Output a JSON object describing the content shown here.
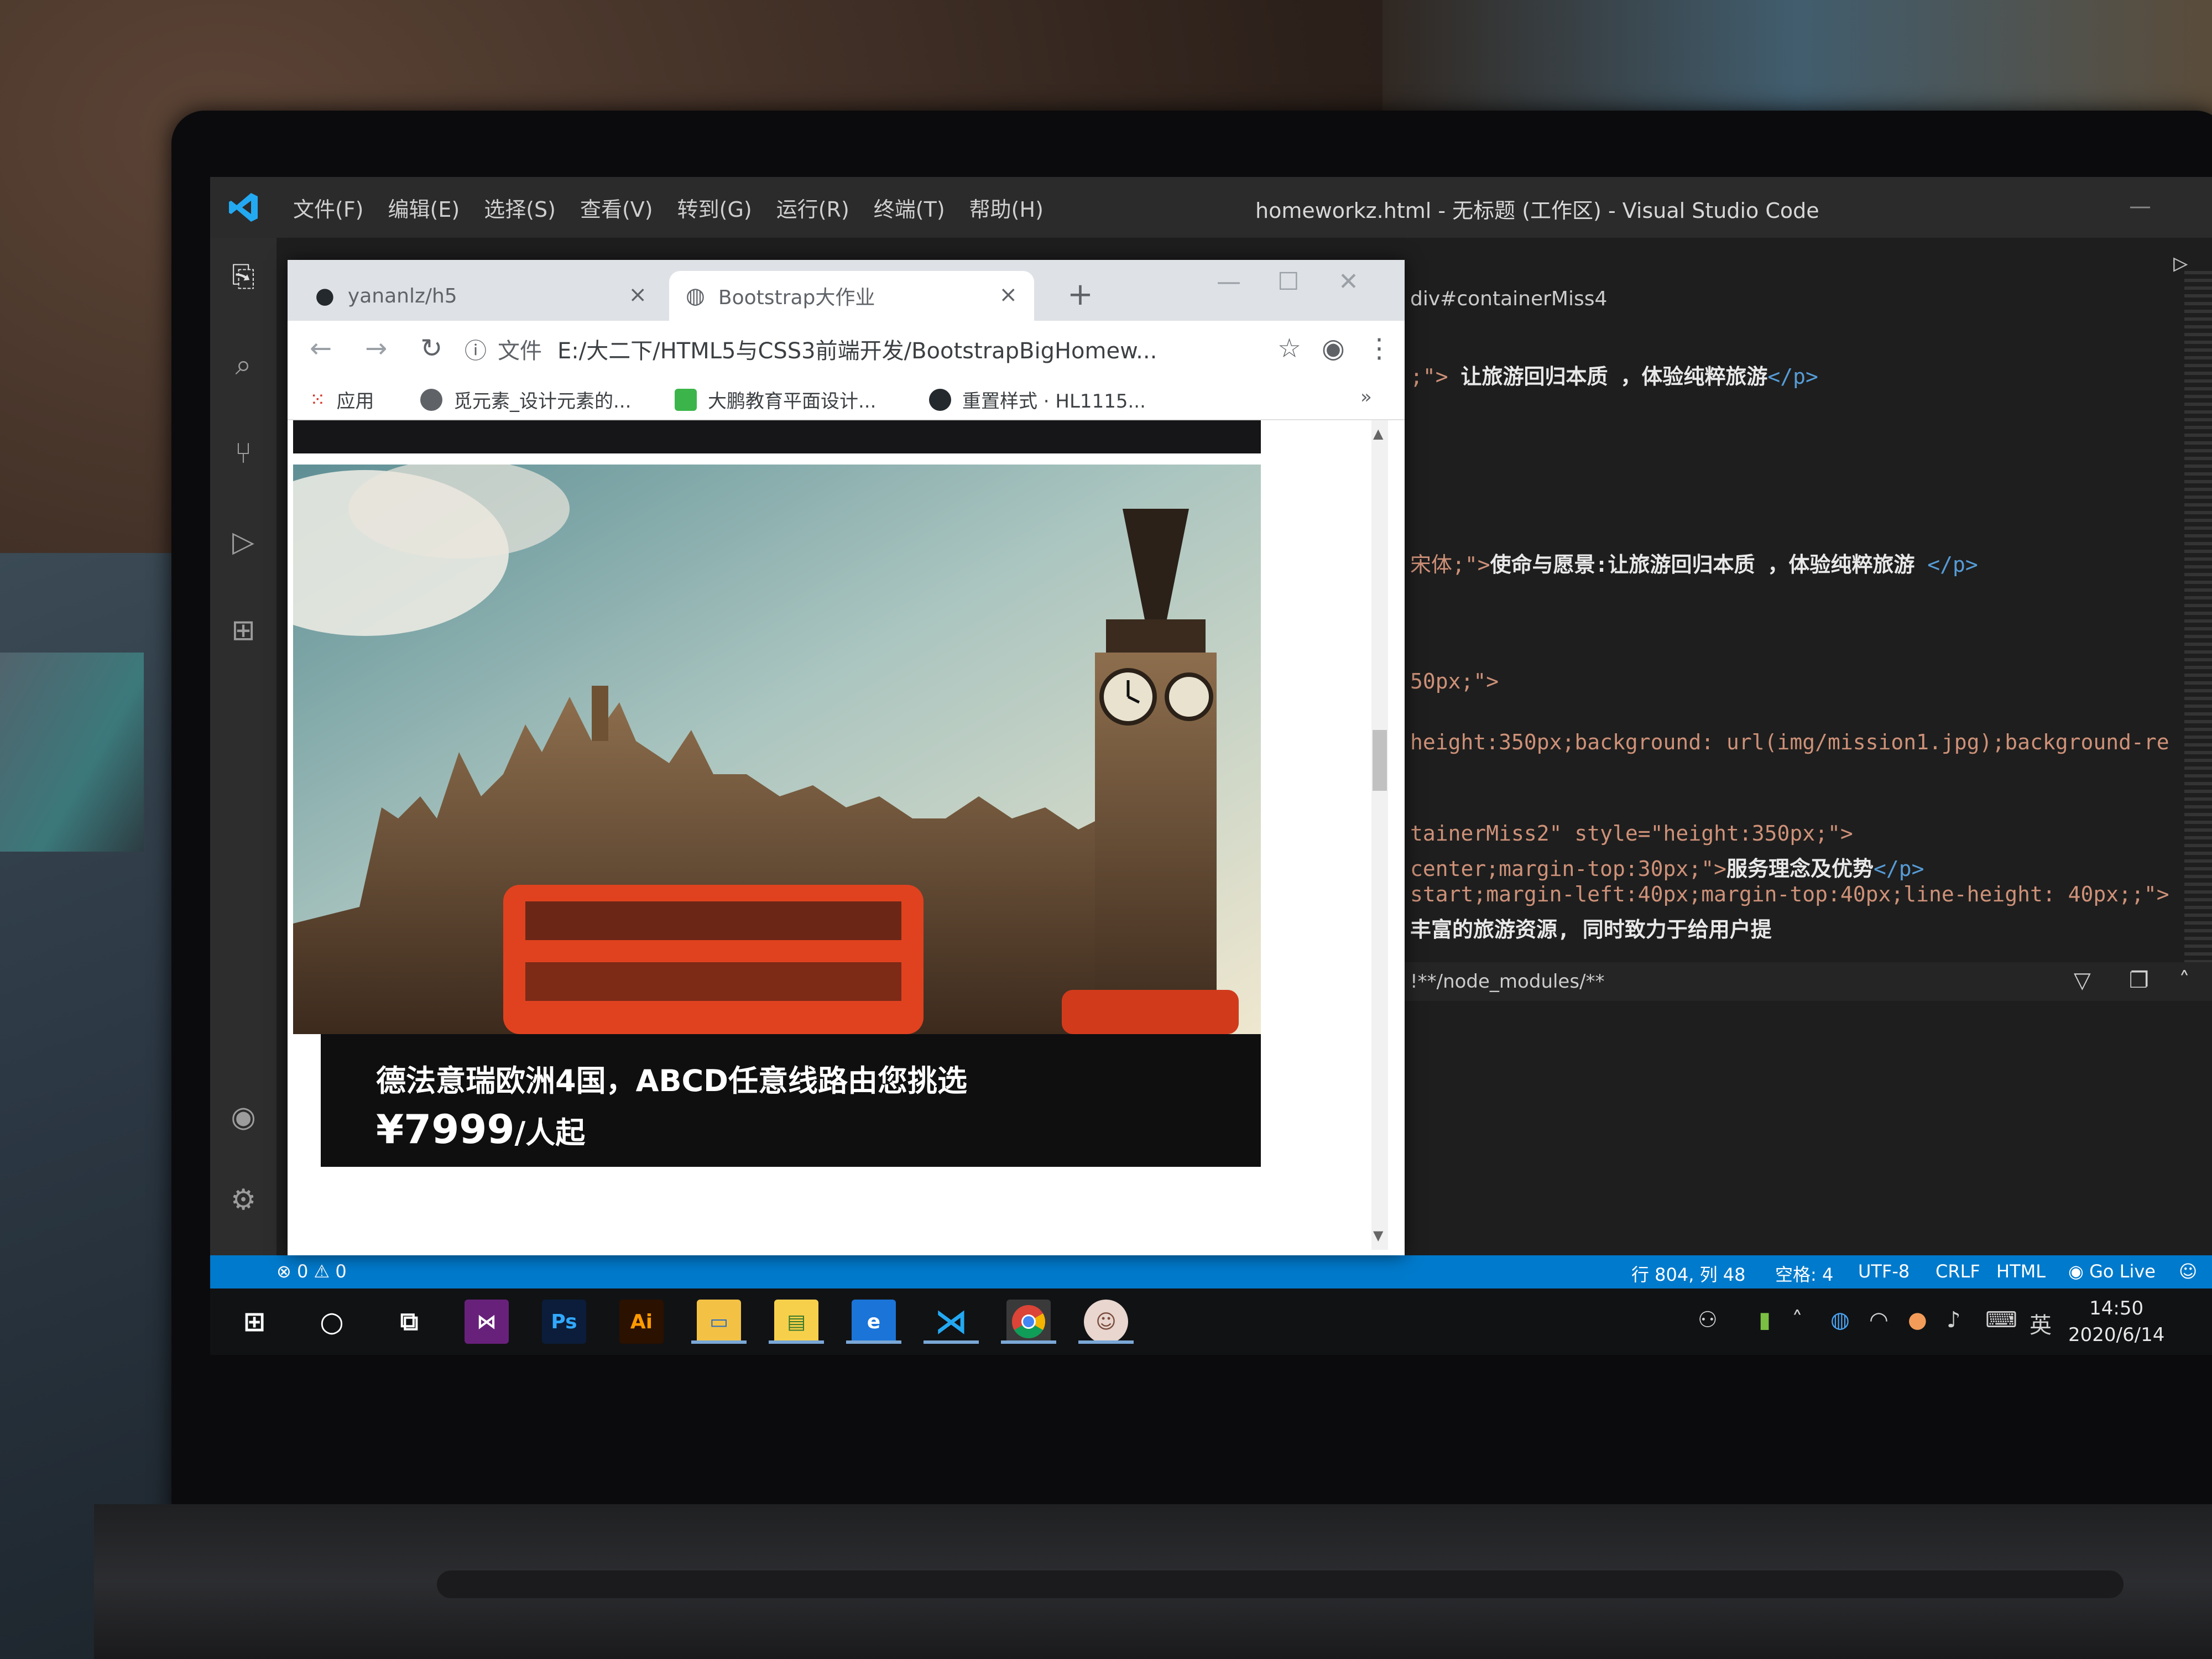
{
  "vscode": {
    "menu": [
      "文件(F)",
      "编辑(E)",
      "选择(S)",
      "查看(V)",
      "转到(G)",
      "运行(R)",
      "终端(T)",
      "帮助(H)"
    ],
    "window_title": "homeworkz.html - 无标题 (工作区) - Visual Studio Code",
    "breadcrumb": "div#containerMiss4",
    "code_lines": [
      {
        "a": ";\">",
        "b": " 让旅游回归本质 ，体验纯粹旅游",
        "c": "</p>"
      },
      {
        "a": "宋体;\">",
        "b": "使命与愿景:让旅游回归本质 ，体验纯粹旅游 ",
        "c": "</p>"
      },
      {
        "a": "50px;\">",
        "b": "",
        "c": ""
      },
      {
        "a": "height:350px;background: url(img/mission1.jpg);background-re",
        "b": "",
        "c": ""
      },
      {
        "a": "tainerMiss2\" style=\"height:350px;\">",
        "b": "",
        "c": ""
      },
      {
        "a": " center;margin-top:30px;\">",
        "b": "服务理念及优势",
        "c": "</p>"
      },
      {
        "a": "start;margin-left:40px;margin-top:40px;line-height: 40px;;\">",
        "b": "",
        "c": ""
      },
      {
        "a": "",
        "b": "丰富的旅游资源, 同时致力于给用户提",
        "c": ""
      }
    ],
    "panel_filter": "!**/node_modules/**",
    "status": {
      "problems": "⊗ 0 ⚠ 0",
      "position": "行 804, 列 48",
      "spaces": "空格: 4",
      "encoding": "UTF-8",
      "eol": "CRLF",
      "language": "HTML",
      "golive": "Go Live"
    }
  },
  "chrome": {
    "tabs": [
      {
        "label": "yananlz/h5",
        "icon": "github-icon"
      },
      {
        "label": "Bootstrap大作业",
        "icon": "globe-icon"
      }
    ],
    "omnibox": {
      "prefix": "文件",
      "url": "E:/大二下/HTML5与CSS3前端开发/BootstrapBigHomew..."
    },
    "bookmarks": [
      "应用",
      "觅元素_设计元素的...",
      "大鹏教育平面设计...",
      "重置样式 · HL1115..."
    ],
    "bookmarks_more": "»"
  },
  "page": {
    "caption_title": "德法意瑞欧洲4国，ABCD任意线路由您挑选",
    "price": "¥7999",
    "price_unit": "/人起"
  },
  "taskbar": {
    "tray_ime": "英",
    "time": "14:50",
    "date": "2020/6/14"
  },
  "colors": {
    "vscode_status": "#007acc",
    "chrome_tabstrip": "#dee1e6",
    "caption_bg": "#0f0f10"
  }
}
